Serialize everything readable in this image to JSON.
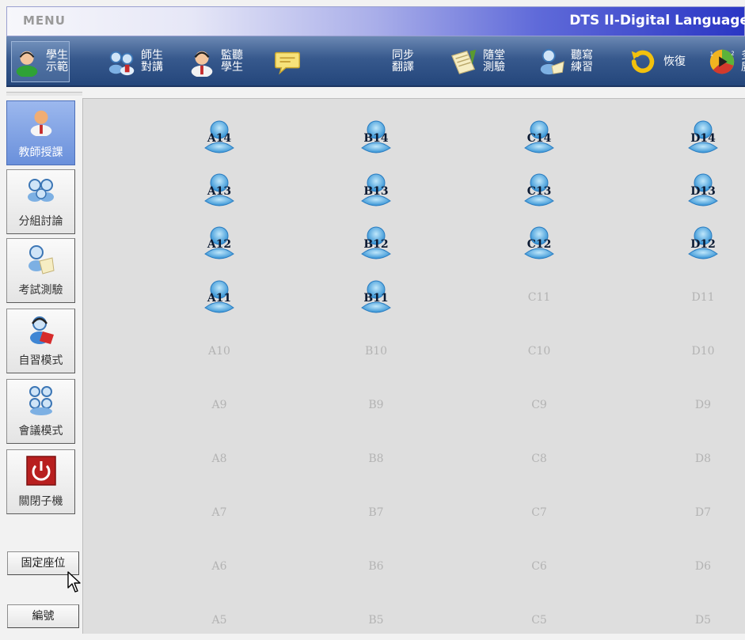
{
  "titlebar": {
    "menu": "MENU",
    "title": "DTS II-Digital Language"
  },
  "toolbar": [
    {
      "label": "學生示範",
      "icon": "student-demo-icon",
      "selected": true
    },
    {
      "label": "師生對講",
      "icon": "teacher-student-talk-icon"
    },
    {
      "label": "監聽學生",
      "icon": "monitor-student-icon"
    },
    {
      "label": "",
      "icon": "speech-bubble-icon"
    },
    {
      "label": "同步翻譯",
      "icon": "translate-icon"
    },
    {
      "label": "隨堂測驗",
      "icon": "quiz-icon"
    },
    {
      "label": "聽寫練習",
      "icon": "dictation-icon"
    },
    {
      "label": "恢復",
      "icon": "restore-icon"
    },
    {
      "label": "多路廣播",
      "icon": "multi-broadcast-icon"
    }
  ],
  "sidebar": {
    "items": [
      {
        "label": "教師授課",
        "icon": "teacher-icon",
        "active": true
      },
      {
        "label": "分組討論",
        "icon": "group-discussion-icon"
      },
      {
        "label": "考試測驗",
        "icon": "exam-icon"
      },
      {
        "label": "自習模式",
        "icon": "self-study-icon"
      },
      {
        "label": "會議模式",
        "icon": "meeting-icon"
      },
      {
        "label": "關閉子機",
        "icon": "power-icon"
      }
    ],
    "fixed_seat_label": "固定座位",
    "number_label": "編號"
  },
  "seats": {
    "columns": [
      "A",
      "B",
      "C",
      "D"
    ],
    "rows": [
      [
        "A14",
        "B14",
        "C14",
        "D14"
      ],
      [
        "A13",
        "B13",
        "C13",
        "D13"
      ],
      [
        "A12",
        "B12",
        "C12",
        "D12"
      ],
      [
        "A11",
        "B11",
        "C11",
        "D11"
      ],
      [
        "A10",
        "B10",
        "C10",
        "D10"
      ],
      [
        "A9",
        "B9",
        "C9",
        "D9"
      ],
      [
        "A8",
        "B8",
        "C8",
        "D8"
      ],
      [
        "A7",
        "B7",
        "C7",
        "D7"
      ],
      [
        "A6",
        "B6",
        "C6",
        "D6"
      ],
      [
        "A5",
        "B5",
        "C5",
        "D5"
      ]
    ],
    "online": [
      "A14",
      "B14",
      "C14",
      "D14",
      "A13",
      "B13",
      "C13",
      "D13",
      "A12",
      "B12",
      "C12",
      "D12",
      "A11",
      "B11"
    ]
  },
  "colors": {
    "toolbar": "#37598d",
    "active_sidebar": "#7a9de0",
    "seat_area": "#dedede",
    "power_red": "#b81f1f"
  }
}
